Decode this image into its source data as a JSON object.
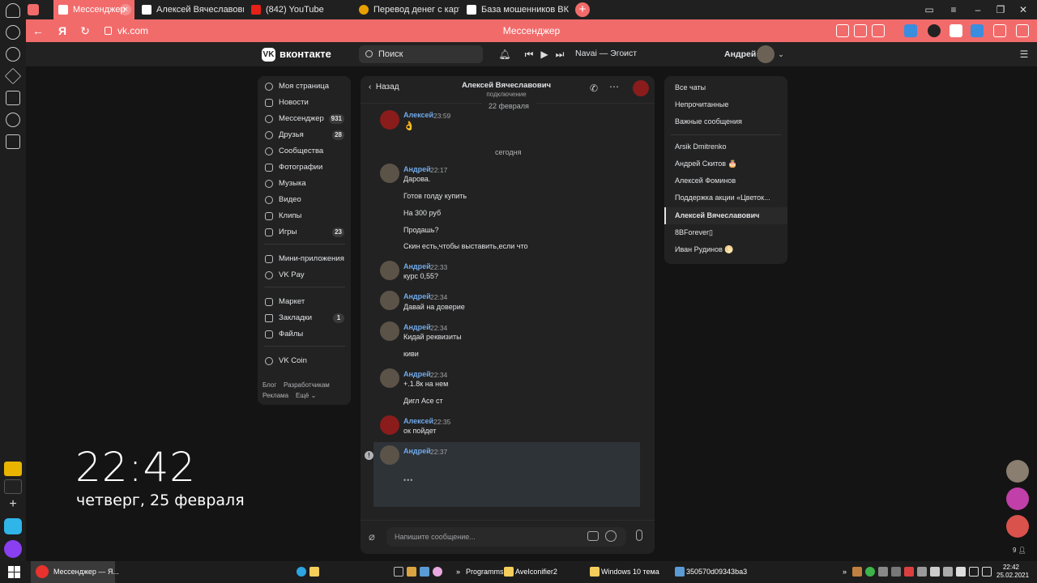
{
  "browser": {
    "tabs": [
      {
        "title": "Мессенджер"
      },
      {
        "title": "Алексей Вячеславович"
      },
      {
        "title": "(842) YouTube"
      },
      {
        "title": "Перевод денег с карты на"
      },
      {
        "title": "База мошенников ВКонта"
      }
    ],
    "close_tab": "×",
    "new_tab": "+",
    "url": "vk.com",
    "page_title": "Мессенджер",
    "yandex_letter": "Я"
  },
  "vk": {
    "logo_letters": "VK",
    "logo_text": "вконтакте",
    "search_placeholder": "Поиск",
    "track": "Navai — Эгоист",
    "user": "Андрей",
    "nav": [
      {
        "label": "Моя страница"
      },
      {
        "label": "Новости"
      },
      {
        "label": "Мессенджер",
        "badge": "931"
      },
      {
        "label": "Друзья",
        "badge": "28"
      },
      {
        "label": "Сообщества"
      },
      {
        "label": "Фотографии"
      },
      {
        "label": "Музыка"
      },
      {
        "label": "Видео"
      },
      {
        "label": "Клипы"
      },
      {
        "label": "Игры",
        "badge": "23"
      },
      {
        "label": "Мини-приложения"
      },
      {
        "label": "VK Pay"
      },
      {
        "label": "Маркет"
      },
      {
        "label": "Закладки",
        "badge": "1"
      },
      {
        "label": "Файлы"
      },
      {
        "label": "VK Coin"
      }
    ],
    "footer": {
      "blog": "Блог",
      "dev": "Разработчикам",
      "ads": "Реклама",
      "more": "Ещё"
    }
  },
  "chat": {
    "back": "Назад",
    "name": "Алексей Вячеславович",
    "status": "подключение",
    "date1": "22 февраля",
    "date2": "сегодня",
    "messages": [
      {
        "name": "Алексей",
        "time": "23:59",
        "lines": [
          "👌"
        ]
      },
      {
        "name": "Андрей",
        "time": "22:17",
        "lines": [
          "Дарова.",
          "Готов голду купить",
          "На 300 руб",
          "Продашь?",
          "Скин есть,чтобы выставить,если что"
        ]
      },
      {
        "name": "Андрей",
        "time": "22:33",
        "lines": [
          "курс 0,55?"
        ]
      },
      {
        "name": "Андрей",
        "time": "22:34",
        "lines": [
          "Давай на доверие"
        ]
      },
      {
        "name": "Андрей",
        "time": "22:34",
        "lines": [
          "Кидай реквизиты",
          "киви"
        ]
      },
      {
        "name": "Андрей",
        "time": "22:34",
        "lines": [
          "+.1.8к на нем",
          "Дигл Асе ст"
        ]
      },
      {
        "name": "Алексей",
        "time": "22:35",
        "lines": [
          "ок пойдет"
        ]
      },
      {
        "name": "Андрей",
        "time": "22:37",
        "lines": []
      }
    ],
    "composer_placeholder": "Напишите сообщение..."
  },
  "filters": [
    {
      "label": "Все чаты"
    },
    {
      "label": "Непрочитанные"
    },
    {
      "label": "Важные сообщения"
    },
    {
      "label": "Arsik Dmitrenko"
    },
    {
      "label": "Андрей Скитов 🎂"
    },
    {
      "label": "Алексей Фоминов"
    },
    {
      "label": "Поддержка акции «Цветок..."
    },
    {
      "label": "Алексей Вячеславович"
    },
    {
      "label": "8BForever▯"
    },
    {
      "label": "Иван Рудинов 🌕"
    }
  ],
  "clock": {
    "time": "22:42",
    "date": "четверг, 25 февраля"
  },
  "side_count": "9",
  "taskbar": {
    "app_title": "Мессенджер — Я...",
    "programs": "Programms",
    "folder1": "AveIconifier2",
    "folder2": "Windows 10 тема",
    "folder3": "350570d09343ba3",
    "time": "22:42",
    "date": "25.02.2021"
  },
  "colors": {
    "accent": "#f26b6b",
    "link": "#71aaeb",
    "panel": "#222222",
    "bg": "#141414"
  }
}
